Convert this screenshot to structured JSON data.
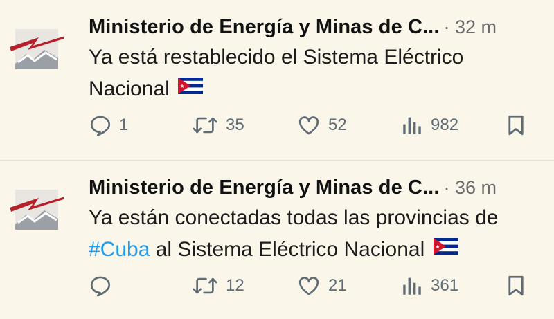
{
  "tweets": [
    {
      "author": "Ministerio de Energía y Minas de C...",
      "time": "· 32 m",
      "text": "Ya está restablecido el Sistema Eléctrico Nacional",
      "replies": "1",
      "retweets": "35",
      "likes": "52",
      "views": "982"
    },
    {
      "author": "Ministerio de Energía y Minas de C...",
      "time": "· 36 m",
      "text_before": "Ya están conectadas todas las provincias de",
      "hashtag": "#Cuba",
      "text_after": "al Sistema Eléctrico Nacional",
      "replies": "",
      "retweets": "12",
      "likes": "21",
      "views": "361"
    }
  ],
  "icons": [
    "reply-icon",
    "retweet-icon",
    "like-icon",
    "views-icon",
    "bookmark-icon",
    "cuba-flag-icon"
  ],
  "colors": {
    "background": "#fbf6ea",
    "hashtag": "#1d9bf0",
    "icon": "#5f6b75",
    "logo_red": "#b5212a"
  }
}
